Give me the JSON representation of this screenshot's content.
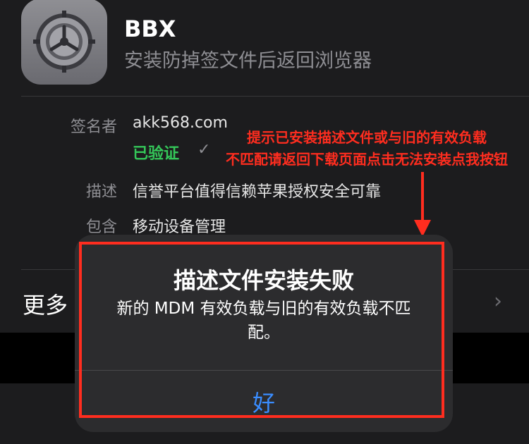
{
  "app": {
    "title": "BBX",
    "subtitle": "安装防掉签文件后返回浏览器"
  },
  "details": {
    "signer_label": "签名者",
    "signer_value": "akk568.com",
    "verified_text": "已验证",
    "verified_mark": "✓",
    "description_label": "描述",
    "description_value": "信誉平台值得信赖苹果授权安全可靠",
    "contains_label": "包含",
    "contains_value": "移动设备管理"
  },
  "more": {
    "label": "更多",
    "chevron": "›"
  },
  "annotation": {
    "line1": "提示已安装描述文件或与旧的有效负载",
    "line2": "不匹配请返回下载页面点击无法安装点我按钮",
    "color": "#ff2d1f"
  },
  "alert": {
    "title": "描述文件安装失败",
    "message": "新的 MDM 有效负载与旧的有效负载不匹配。",
    "ok_label": "好"
  },
  "colors": {
    "background": "#1c1c1e",
    "verified": "#34c759",
    "link": "#3a8dff"
  },
  "icons": {
    "app_icon": "settings-gear-icon",
    "chevron": "chevron-right-icon",
    "arrow": "arrow-down-icon"
  }
}
